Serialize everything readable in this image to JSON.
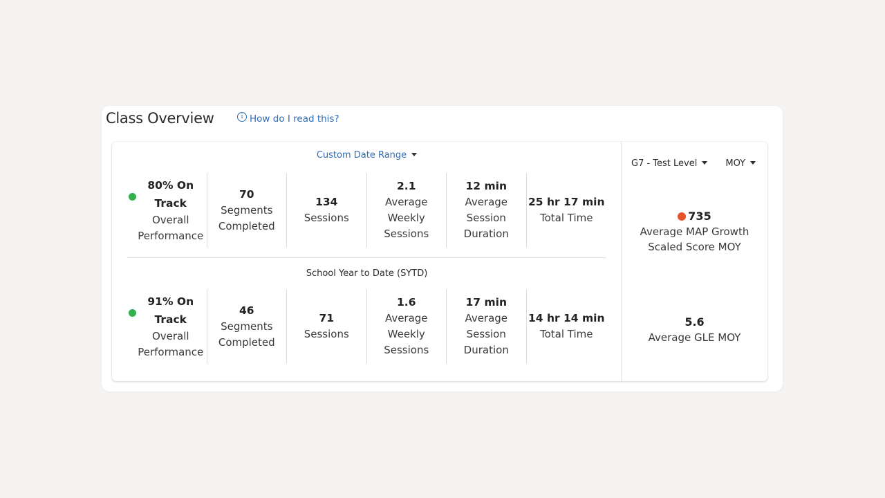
{
  "card": {
    "title": "Class Overview",
    "help_label": "How do I read this?",
    "help_icon": "info-icon"
  },
  "custom_range": {
    "label": "Custom Date Range",
    "overall_value": "80% On Track",
    "overall_label": "Overall Performance",
    "status_color": "#2fb24a",
    "segments_value": "70",
    "segments_label": "Segments Completed",
    "sessions_value": "134",
    "sessions_label": "Sessions",
    "weekly_value": "2.1",
    "weekly_label": "Average Weekly Sessions",
    "duration_value": "12 min",
    "duration_label": "Average Session Duration",
    "total_value": "25 hr 17 min",
    "total_label": "Total Time"
  },
  "sytd": {
    "label": "School Year to Date (SYTD)",
    "overall_value": "91% On Track",
    "overall_label": "Overall Performance",
    "status_color": "#2fb24a",
    "segments_value": "46",
    "segments_label": "Segments Completed",
    "sessions_value": "71",
    "sessions_label": "Sessions",
    "weekly_value": "1.6",
    "weekly_label": "Average Weekly Sessions",
    "duration_value": "17 min",
    "duration_label": "Average Session Duration",
    "total_value": "14 hr 14 min",
    "total_label": "Total Time"
  },
  "right": {
    "level_dropdown": "G7 - Test Level",
    "term_dropdown": "MOY",
    "map_value": "735",
    "map_label": "Average MAP Growth Scaled Score MOY",
    "map_status_color": "#e8542a",
    "gle_value": "5.6",
    "gle_label": "Average GLE MOY"
  }
}
